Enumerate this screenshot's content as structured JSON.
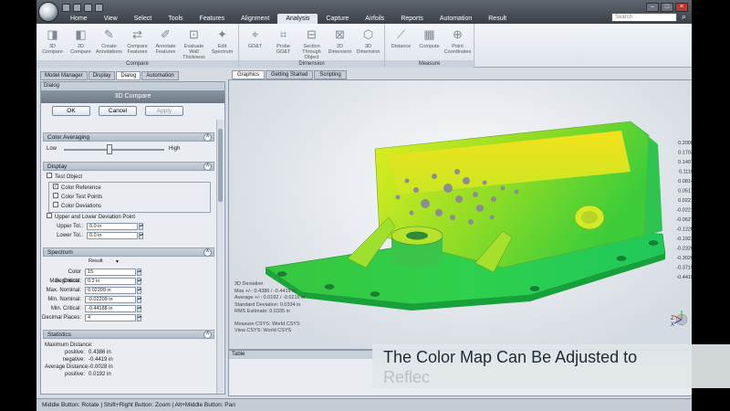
{
  "menu": {
    "tabs": [
      "Home",
      "View",
      "Select",
      "Tools",
      "Features",
      "Alignment",
      "Analysis",
      "Capture",
      "Airfoils",
      "Reports",
      "Automation",
      "Result"
    ],
    "active_index": 6,
    "search_placeholder": "Search"
  },
  "ribbon": {
    "groups": [
      {
        "label": "Compare",
        "buttons": [
          "3D Compare",
          "2D Compare",
          "Create Annotations",
          "Compare Features",
          "Annotate Features",
          "Evaluate Wall Thickness",
          "Edit Spectrum"
        ]
      },
      {
        "label": "Dimension",
        "buttons": [
          "GD&T",
          "Probe GD&T",
          "Section Through Object",
          "2D Dimension",
          "3D Dimension"
        ]
      },
      {
        "label": "Measure",
        "buttons": [
          "Distance",
          "Compute",
          "Point Coordinates"
        ]
      }
    ]
  },
  "left_tabs": [
    "Model Manager",
    "Display",
    "Dialog",
    "Automation"
  ],
  "left_active_tab": 2,
  "dialog": {
    "header": "Dialog",
    "title": "3D Compare",
    "ok": "OK",
    "cancel": "Cancel",
    "apply": "Apply",
    "color_averaging": {
      "title": "Color Averaging",
      "low": "Low",
      "high": "High",
      "level": 0.45
    },
    "display": {
      "title": "Display",
      "test_object": "Test Object",
      "color_reference": "Color Reference",
      "color_test_points": "Color Test Points",
      "color_deviations": "Color Deviations",
      "upper_lower": "Upper and Lower Deviation Point",
      "upper_tol_label": "Upper Tol.:",
      "upper_tol": "0.0 in",
      "lower_tol_label": "Lower Tol.:",
      "lower_tol": "0.0 in"
    },
    "spectrum": {
      "title": "Spectrum",
      "mode": "Result",
      "color_segments_label": "Color Segments:",
      "color_segments": "15",
      "max_critical_label": "Max. Critical:",
      "max_critical": "0.2 in",
      "max_nominal_label": "Max. Nominal:",
      "max_nominal": "0.02209 in",
      "min_nominal_label": "Min. Nominal:",
      "min_nominal": "-0.02209 in",
      "min_critical_label": "Min. Critical:",
      "min_critical": "-0.44188 in",
      "decimal_places_label": "Decimal Places:",
      "decimal_places": "4"
    },
    "statistics": {
      "title": "Statistics",
      "max_distance_label": "Maximum Distance:",
      "positive_label": "positive:",
      "positive": "0.4386 in",
      "negative_label": "negative:",
      "negative": "-0.4419 in",
      "avg_distance_label": "Average Distance:",
      "avg_distance": "-0.0028 in",
      "avg_positive": "0.0192 in"
    }
  },
  "graphics_tabs": [
    "Graphics",
    "Getting Started",
    "Scripting"
  ],
  "graphics_active_tab": 0,
  "legend": {
    "values": [
      "0.2000",
      "0.1703",
      "0.1407",
      "0.1110",
      "0.0814",
      "0.0517",
      "0.0221",
      "-0.0221",
      "-0.0627",
      "-0.1220",
      "-0.1923",
      "-0.2320",
      "-0.3020",
      "-0.3719",
      "-0.4419"
    ],
    "colors": [
      "#d0021b",
      "#e8300e",
      "#f06a10",
      "#f5a512",
      "#f7d418",
      "#e6ee1c",
      "#b6ea22",
      "#27c83e",
      "#18c8a8",
      "#14b8e0",
      "#1592ea",
      "#1b6ae8",
      "#1e45d6",
      "#2230b8",
      "#1d1f8a"
    ]
  },
  "deviation_info": {
    "title": "3D Deviation",
    "max": "Max +/-: 0.4386 / -0.4419 in",
    "average": "Average +/-: 0.0192 / -0.0216 in",
    "std_dev": "Standard Deviation: 0.0334 in",
    "rms": "RMS Estimate: 0.0335 in",
    "measure_csys": "Measure CSYS: World CSYS",
    "view_csys": "View CSYS: World CSYS"
  },
  "axis": {
    "x": "X",
    "y": "Y",
    "z": "Z"
  },
  "table_header": "Table",
  "status": "Middle Button: Rotate | Shift+Right Button: Zoom | Alt+Middle Button: Pan",
  "caption": {
    "line1": "The Color Map Can Be Adjusted to",
    "line2": "Reflec"
  }
}
